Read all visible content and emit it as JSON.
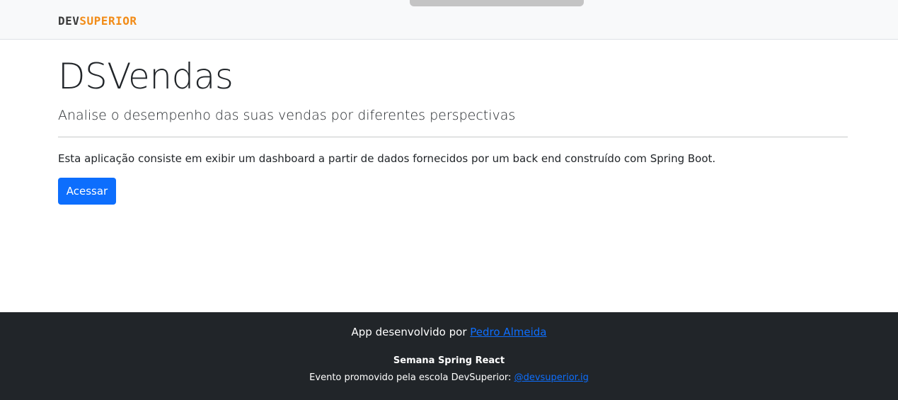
{
  "navbar": {
    "logo_dev": "DEV",
    "logo_superior": "SUPERIOR"
  },
  "main": {
    "title": "DSVendas",
    "subtitle": "Analise o desempenho das suas vendas por diferentes perspectivas",
    "description": "Esta aplicação consiste em exibir um dashboard a partir de dados fornecidos por um back end construído com Spring Boot.",
    "button_label": "Acessar"
  },
  "footer": {
    "line1_prefix": "App desenvolvido por ",
    "author_link": "Pedro Almeida",
    "event_name": "Semana Spring React",
    "line3_prefix": "Evento promovido pela escola DevSuperior: ",
    "instagram_link": "@devsuperior.ig"
  },
  "colors": {
    "accent": "#0d6efd",
    "logo_orange": "#f28c18",
    "footer_bg": "#212529",
    "navbar_bg": "#f8f9fa"
  }
}
